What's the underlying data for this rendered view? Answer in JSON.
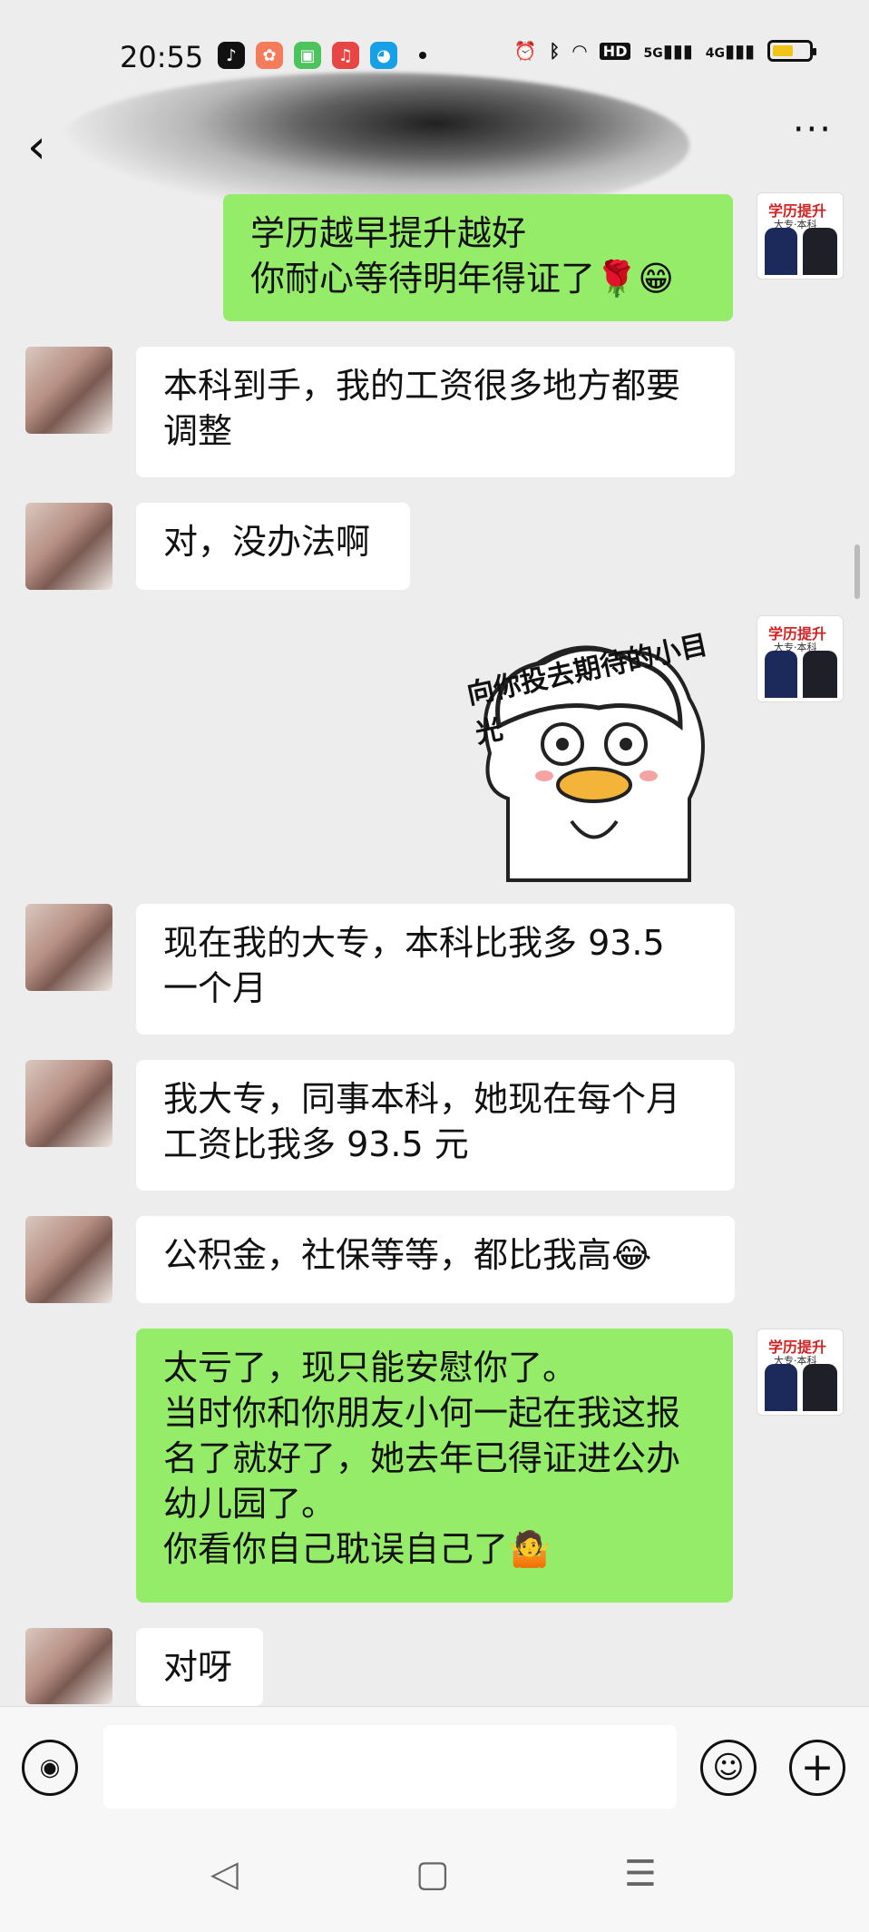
{
  "status_bar": {
    "time": "20:55",
    "network_labels": [
      "HD",
      "5G",
      "4G"
    ]
  },
  "title_bar": {
    "more_label": "···"
  },
  "messages": [
    {
      "side": "right",
      "lines": "学历越早提升越好\n你耐心等待明年得证了🌹😁"
    },
    {
      "side": "left",
      "lines": "本科到手，我的工资很多地方都要\n调整"
    },
    {
      "side": "left",
      "lines": "对，没办法啊"
    },
    {
      "side": "right",
      "type": "sticker",
      "sticker_text": "向你投去期待的小目光"
    },
    {
      "side": "left",
      "lines": "现在我的大专，本科比我多 93.5\n一个月"
    },
    {
      "side": "left",
      "lines": "我大专，同事本科，她现在每个月\n工资比我多 93.5 元"
    },
    {
      "side": "left",
      "lines": "公积金，社保等等，都比我高😂"
    },
    {
      "side": "right",
      "lines": "太亏了，现只能安慰你了。\n当时你和你朋友小何一起在我这报\n名了就好了，她去年已得证进公办\n幼儿园了。\n你看你自己耽误自己了🤷"
    },
    {
      "side": "left",
      "lines": "对呀"
    }
  ],
  "avatar_text": {
    "title": "学历提升",
    "subtitle": "大专·本科"
  },
  "input_bar": {
    "placeholder": ""
  },
  "nav_bar": {
    "back": "◁",
    "home": "▢",
    "menu": "☰"
  },
  "colors": {
    "background": "#ededed",
    "left_bubble": "#ffffff",
    "right_bubble": "#95ec69"
  }
}
